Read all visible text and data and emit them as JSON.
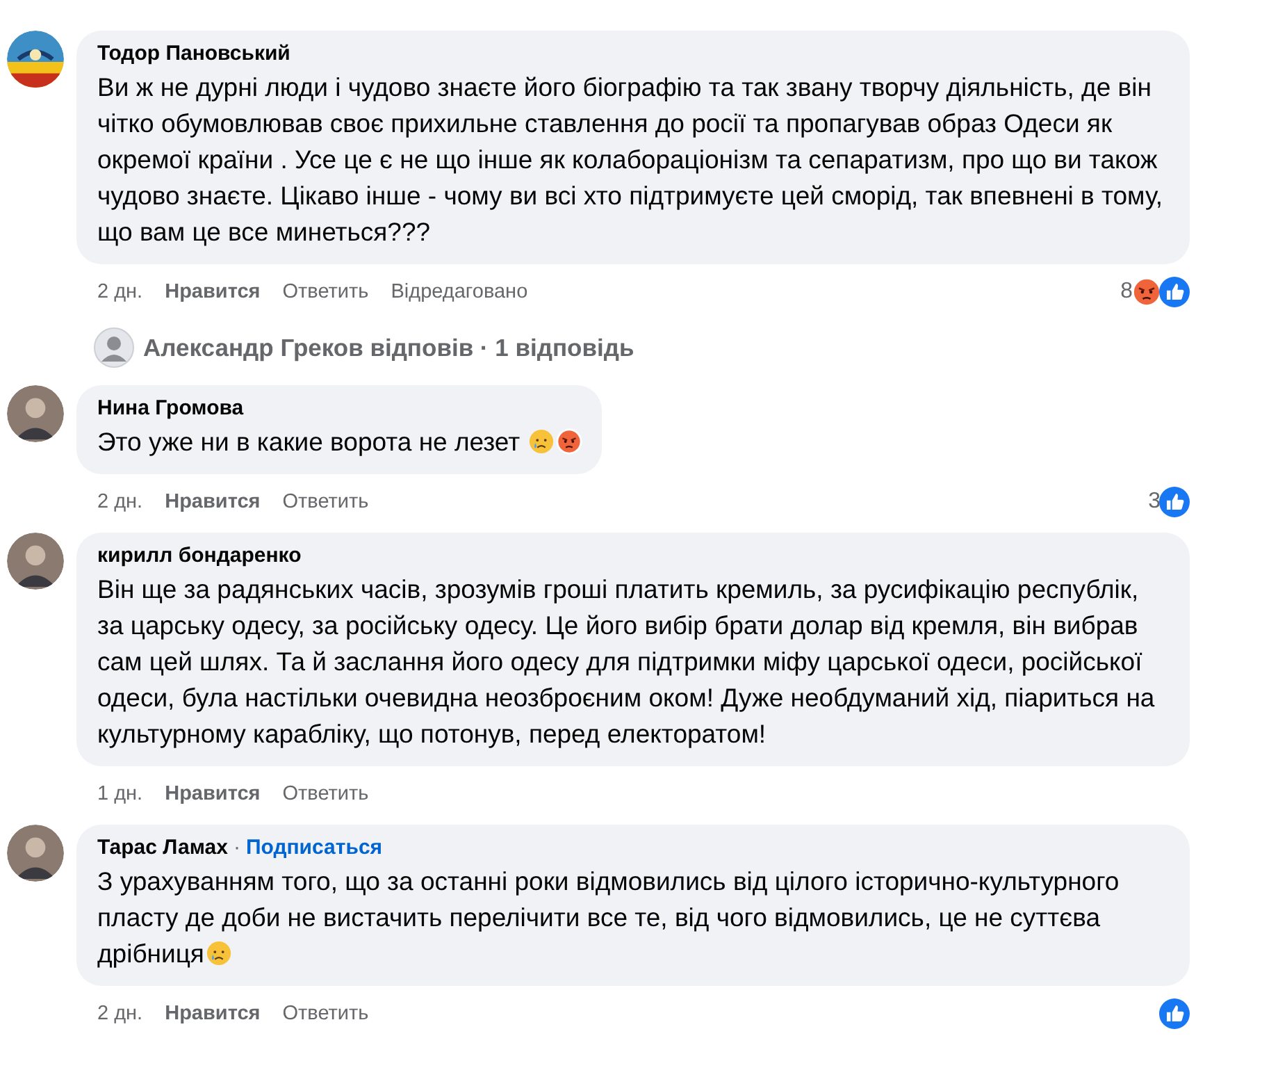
{
  "comments": [
    {
      "author": "Тодор Пановський",
      "avatar": {
        "kind": "emblem"
      },
      "text": "Ви ж не дурні люди і чудово знаєте його біографію та так звану творчу діяльність, де він чітко обумовлював своє прихильне ставлення до росії та пропагував образ Одеси як окремої країни . Усе це є не що інше як колабораціонізм та сепаратизм, про що ви також чудово знаєте. Цікаво інше - чому ви всі хто підтримуєте цей сморід, так впевнені в тому, що вам це все минеться???",
      "time": "2 дн.",
      "like": "Нравится",
      "reply": "Ответить",
      "edited": "Відредаговано",
      "reaction_count": "8",
      "reactions": [
        {
          "kind": "angry"
        },
        {
          "kind": "like"
        }
      ],
      "replies_summary": {
        "text": "Александр Греков відповів · 1 відповідь"
      }
    },
    {
      "author": "Нина Громова",
      "avatar": {
        "kind": "photo"
      },
      "text": "Это уже ни в какие ворота не лезет ",
      "emojis": [
        {
          "kind": "sad"
        },
        {
          "kind": "angry"
        }
      ],
      "time": "2 дн.",
      "like": "Нравится",
      "reply": "Ответить",
      "reaction_count": "3",
      "reactions": [
        {
          "kind": "like"
        }
      ]
    },
    {
      "author": "кирилл бондаренко",
      "avatar": {
        "kind": "photo"
      },
      "text": "Він ще за радянських часів, зрозумів гроші платить кремиль, за русифікацію республік, за царську одесу, за російську одесу. Це його вибір брати долар від кремля, він вибрав сам цей шлях. Та й заслання його одесу для підтримки міфу царської одеси, російської одеси, була настільки очевидна неозброєним оком! Дуже необдуманий хід, піариться на культурному карабліку, що потонув, перед електоратом!",
      "time": "1 дн.",
      "like": "Нравится",
      "reply": "Ответить"
    },
    {
      "author": "Тарас Ламах",
      "avatar": {
        "kind": "photo"
      },
      "separator": "·",
      "follow": "Подписаться",
      "text": "З урахуванням того, що за останні роки відмовились від цілого історично-культурного пласту де доби не вистачить перелічити все те, від чого відмовились, це не суттєва дрібниця",
      "emojis": [
        {
          "kind": "sad"
        }
      ],
      "time": "2 дн.",
      "like": "Нравится",
      "reply": "Ответить",
      "reactions": [
        {
          "kind": "like"
        }
      ]
    }
  ]
}
